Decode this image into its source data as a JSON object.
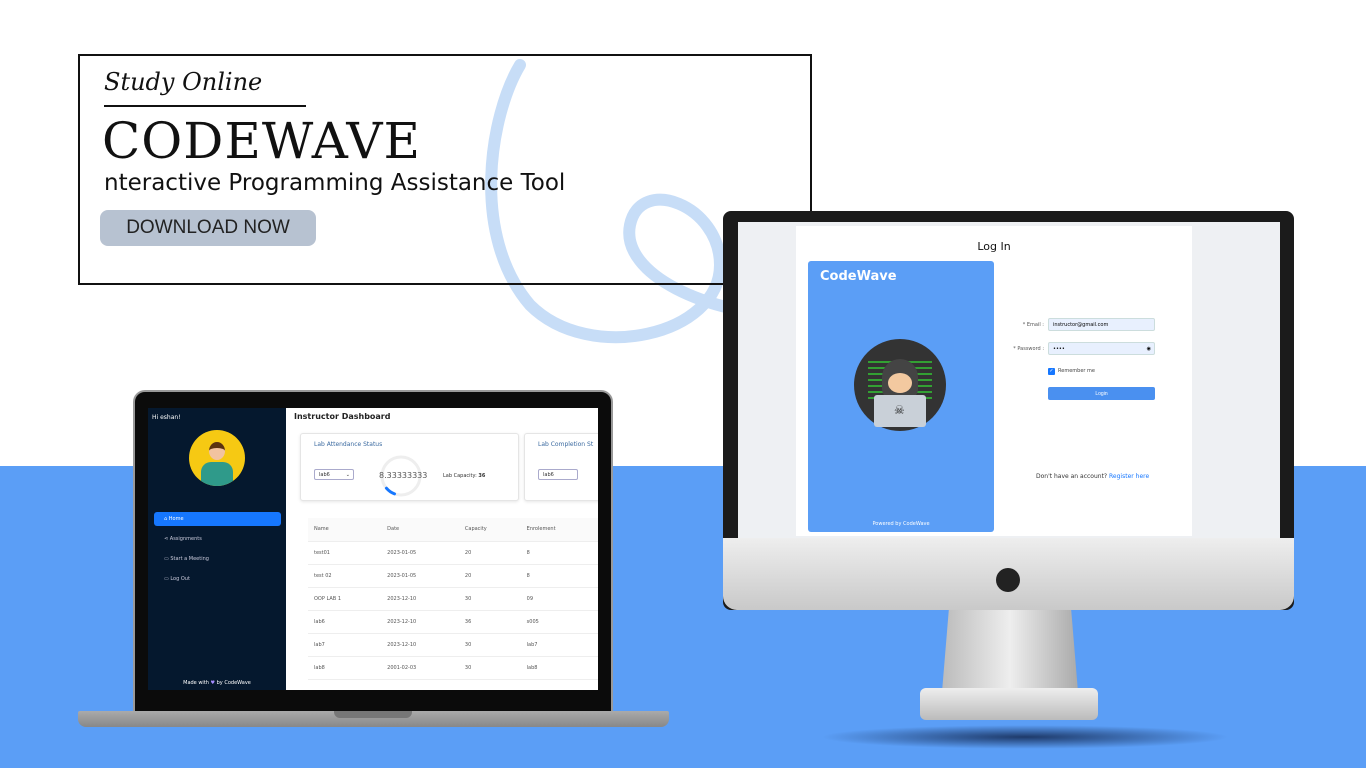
{
  "banner": {
    "tagline": "Study Online",
    "brand": "CODEWAVE",
    "subtitle": "nteractive Programming Assistance Tool",
    "download_label": "DOWNLOAD NOW"
  },
  "colors": {
    "background_blue": "#5b9ef6",
    "sidebar": "#05182e",
    "accent": "#1677ff"
  },
  "dashboard": {
    "greeting": "Hi eshan!",
    "title": "Instructor Dashboard",
    "nav": [
      {
        "label": "Home",
        "icon": "home-icon"
      },
      {
        "label": "Assignments",
        "icon": "share-icon"
      },
      {
        "label": "Start a Meeting",
        "icon": "video-icon"
      },
      {
        "label": "Log Out",
        "icon": "logout-icon"
      }
    ],
    "footer": "Made with",
    "footer_by": "by CodeWave",
    "attendance": {
      "title": "Lab Attendance Status",
      "select": "lab6",
      "value": "8.33333333",
      "progress_percent": 8.33,
      "capacity_label": "Lab Capacity:",
      "capacity": "36"
    },
    "completion": {
      "title": "Lab Completion St",
      "select": "lab6"
    },
    "table": {
      "headers": [
        "Name",
        "Date",
        "Capacity",
        "Enrolement"
      ],
      "rows": [
        [
          "test01",
          "2023-01-05",
          "20",
          "8"
        ],
        [
          "test 02",
          "2023-01-05",
          "20",
          "8"
        ],
        [
          "OOP LAB 1",
          "2023-12-10",
          "30",
          "09"
        ],
        [
          "lab6",
          "2023-12-10",
          "36",
          "s005"
        ],
        [
          "lab7",
          "2023-12-10",
          "30",
          "lab7"
        ],
        [
          "lab8",
          "2001-02-03",
          "30",
          "lab8"
        ]
      ]
    }
  },
  "login": {
    "title": "Log In",
    "brand": "CodeWave",
    "powered": "Powered by CodeWave",
    "email_label": "* Email :",
    "email_value": "instructor@gmail.com",
    "password_label": "* Password :",
    "password_value": "••••",
    "remember": "Remember me",
    "login_button": "Login",
    "no_account": "Don't have an account?",
    "register": "Register here"
  }
}
